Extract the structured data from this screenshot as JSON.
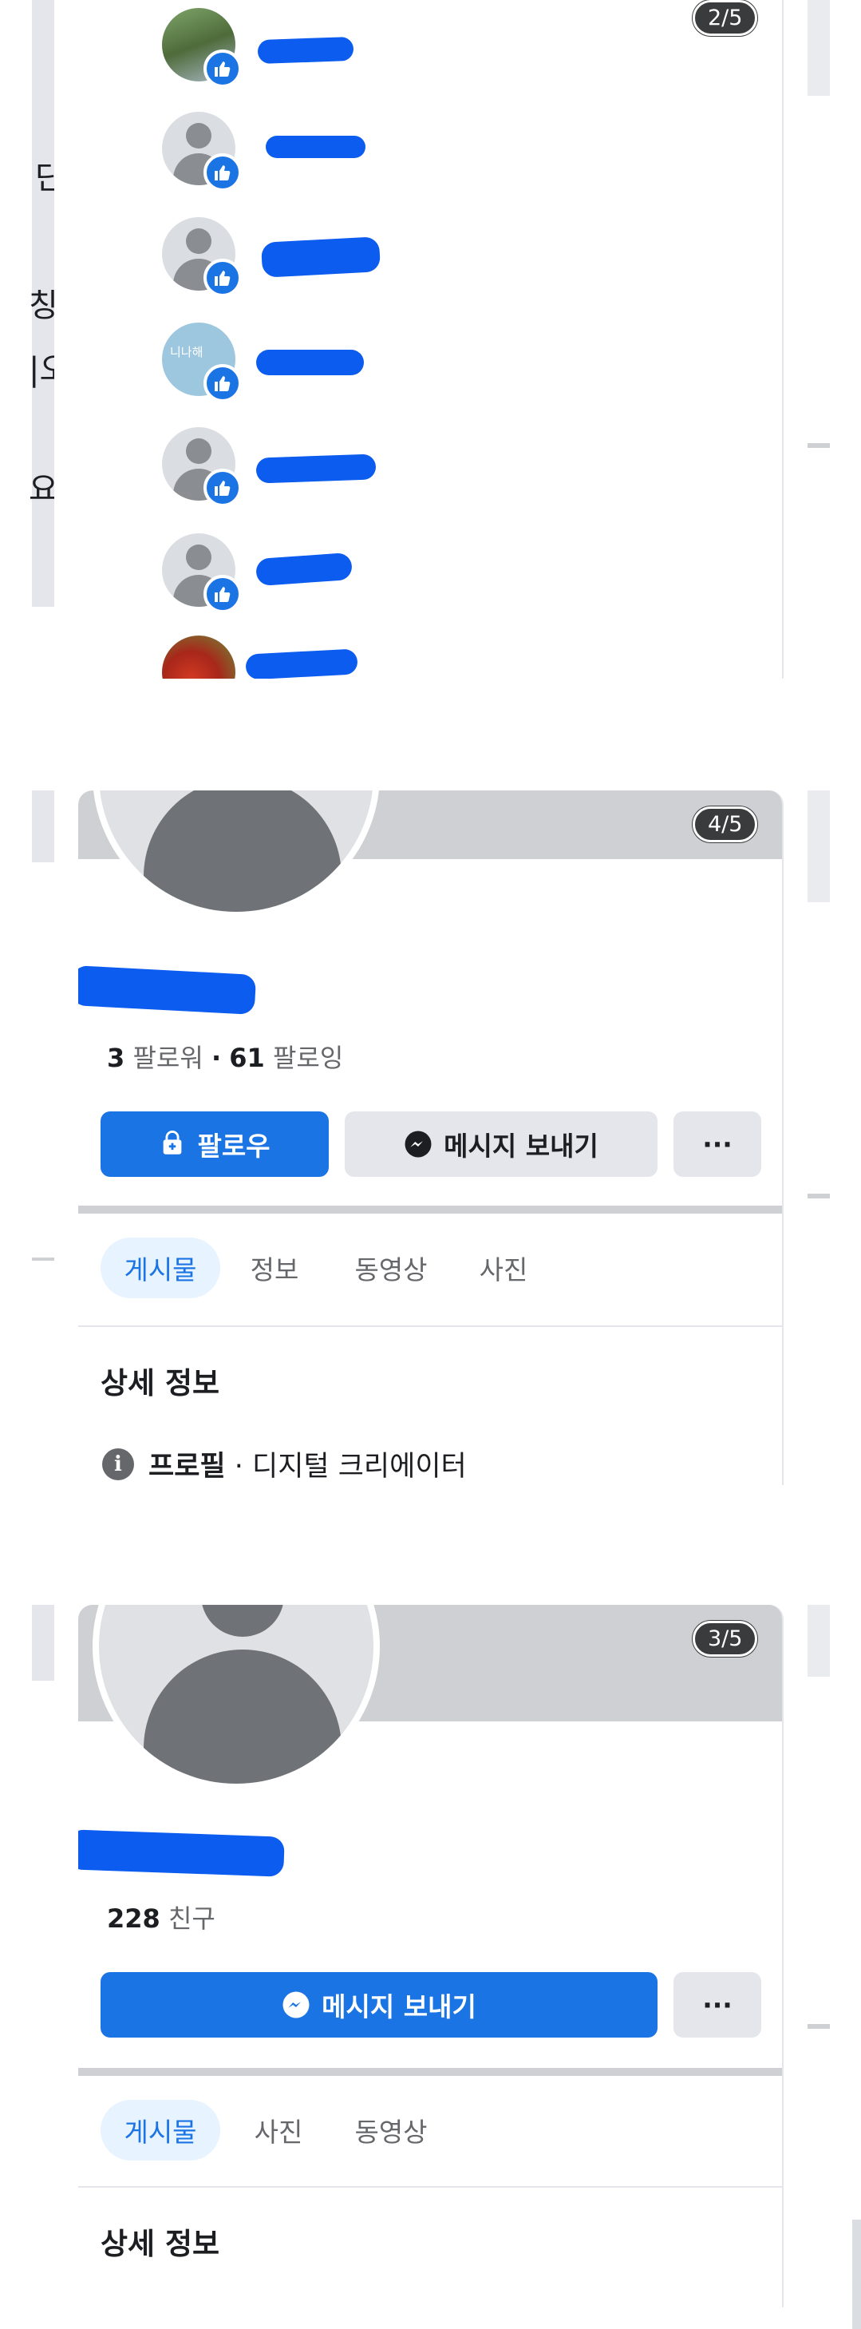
{
  "likes_panel": {
    "counter": "2/5",
    "avatar_teal_label": "니나해"
  },
  "profile_a": {
    "counter": "4/5",
    "followers_count": "3",
    "followers_label": "팔로워",
    "following_count": "61",
    "following_label": "팔로잉",
    "separator": "·",
    "follow_button": "팔로우",
    "message_button": "메시지 보내기",
    "more_button": "···",
    "tabs": [
      "게시물",
      "정보",
      "동영상",
      "사진"
    ],
    "details_title": "상세 정보",
    "details_bold": "프로필",
    "details_text": "· 디지털 크리에이터"
  },
  "profile_b": {
    "counter": "3/5",
    "friends_count": "228",
    "friends_label": "친구",
    "message_button": "메시지 보내기",
    "more_button": "···",
    "tabs": [
      "게시물",
      "사진",
      "동영상"
    ],
    "details_title": "상세 정보"
  },
  "edge_text": {
    "a": "단",
    "b": "칭",
    "c": "|오",
    "d": "요?"
  },
  "colors": {
    "facebook_blue": "#1b74e4",
    "redaction_blue": "#0c5cf0",
    "badge_dark": "#3a3b3c"
  }
}
